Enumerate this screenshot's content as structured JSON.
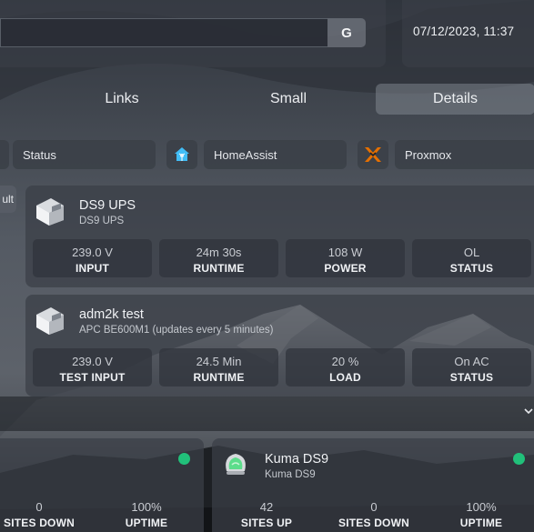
{
  "search": {
    "placeholder": "",
    "button_label": "G"
  },
  "datetime": "07/12/2023, 11:37",
  "tabs": [
    {
      "label": "Links",
      "active": false
    },
    {
      "label": "Small",
      "active": false
    },
    {
      "label": "Details",
      "active": true
    }
  ],
  "services": [
    {
      "label": "Status",
      "icon": "status-icon"
    },
    {
      "label": "HomeAssist",
      "icon": "home-assistant-icon"
    },
    {
      "label": "Proxmox",
      "icon": "proxmox-icon"
    }
  ],
  "side_stub": "ult",
  "ups": [
    {
      "title": "DS9 UPS",
      "subtitle": "DS9 UPS",
      "icon": "ups-icon",
      "stats": [
        {
          "value": "239.0 V",
          "label": "INPUT"
        },
        {
          "value": "24m 30s",
          "label": "RUNTIME"
        },
        {
          "value": "108 W",
          "label": "POWER"
        },
        {
          "value": "OL",
          "label": "STATUS"
        }
      ]
    },
    {
      "title": "adm2k test",
      "subtitle": "APC BE600M1 (updates every 5 minutes)",
      "icon": "ups-icon",
      "stats": [
        {
          "value": "239.0 V",
          "label": "TEST INPUT"
        },
        {
          "value": "24.5 Min",
          "label": "RUNTIME"
        },
        {
          "value": "20 %",
          "label": "LOAD"
        },
        {
          "value": "On AC",
          "label": "STATUS"
        }
      ]
    }
  ],
  "kuma": [
    {
      "title": "",
      "subtitle": "",
      "status_color": "#21c07a",
      "stats": [
        {
          "value": "0",
          "label": "SITES DOWN"
        },
        {
          "value": "100%",
          "label": "UPTIME"
        }
      ]
    },
    {
      "title": "Kuma DS9",
      "subtitle": "Kuma DS9",
      "icon": "uptime-kuma-icon",
      "status_color": "#21c07a",
      "stats": [
        {
          "value": "42",
          "label": "SITES UP"
        },
        {
          "value": "0",
          "label": "SITES DOWN"
        },
        {
          "value": "100%",
          "label": "UPTIME"
        }
      ]
    }
  ],
  "colors": {
    "status_ok": "#21c07a",
    "proxmox_orange": "#e57000",
    "home_assistant_blue": "#41bdf5"
  }
}
